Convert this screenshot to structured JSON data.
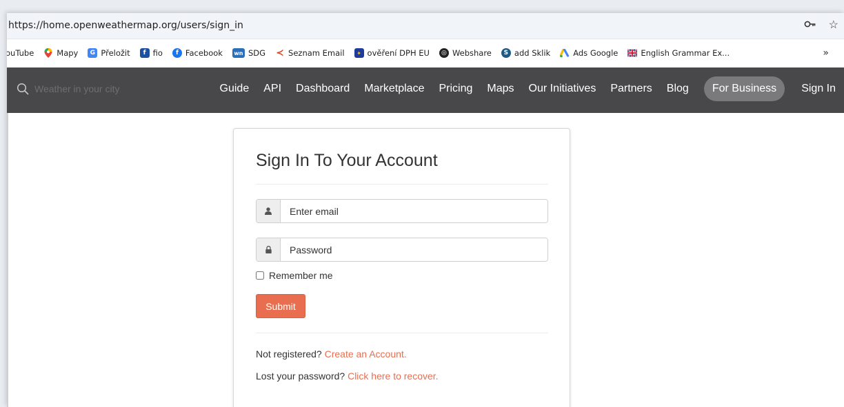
{
  "browser": {
    "url": "https://home.openweathermap.org/users/sign_in",
    "key_icon": "key-icon",
    "star_icon": "star-icon"
  },
  "bookmarks": {
    "items": [
      {
        "label": "ouTube",
        "icon": "youtube-icon",
        "color": "#ff0000"
      },
      {
        "label": "Mapy",
        "icon": "maps-pin-icon",
        "color": "#34a853"
      },
      {
        "label": "Přeložit",
        "icon": "translate-icon",
        "color": "#4285f4"
      },
      {
        "label": "fio",
        "icon": "fio-icon",
        "color": "#1b4fa0"
      },
      {
        "label": "Facebook",
        "icon": "facebook-icon",
        "color": "#1877f2"
      },
      {
        "label": "SDG",
        "icon": "sdg-icon",
        "color": "#2a6fb7"
      },
      {
        "label": "Seznam Email",
        "icon": "seznam-icon",
        "color": "#e2471a"
      },
      {
        "label": "ověření DPH EU",
        "icon": "eu-flag-icon",
        "color": "#1f3b9c"
      },
      {
        "label": "Webshare",
        "icon": "webshare-icon",
        "color": "#222222"
      },
      {
        "label": "add Sklik",
        "icon": "sklik-icon",
        "color": "#1d5a85"
      },
      {
        "label": "Ads Google",
        "icon": "google-ads-icon",
        "color": "#fbbc04"
      },
      {
        "label": "English Grammar Ex...",
        "icon": "uk-flag-icon",
        "color": "#c8102e"
      }
    ],
    "more": "»"
  },
  "nav": {
    "search_placeholder": "Weather in your city",
    "links": [
      "Guide",
      "API",
      "Dashboard",
      "Marketplace",
      "Pricing",
      "Maps",
      "Our Initiatives",
      "Partners",
      "Blog"
    ],
    "for_business": "For Business",
    "sign_in": "Sign In"
  },
  "form": {
    "title": "Sign In To Your Account",
    "email_placeholder": "Enter email",
    "password_placeholder": "Password",
    "remember_label": "Remember me",
    "submit_label": "Submit",
    "not_registered": "Not registered?",
    "create_account": "Create an Account.",
    "lost_password": "Lost your password?",
    "recover": "Click here to recover."
  },
  "colors": {
    "accent": "#e96e50",
    "nav_bg": "#48484a"
  }
}
